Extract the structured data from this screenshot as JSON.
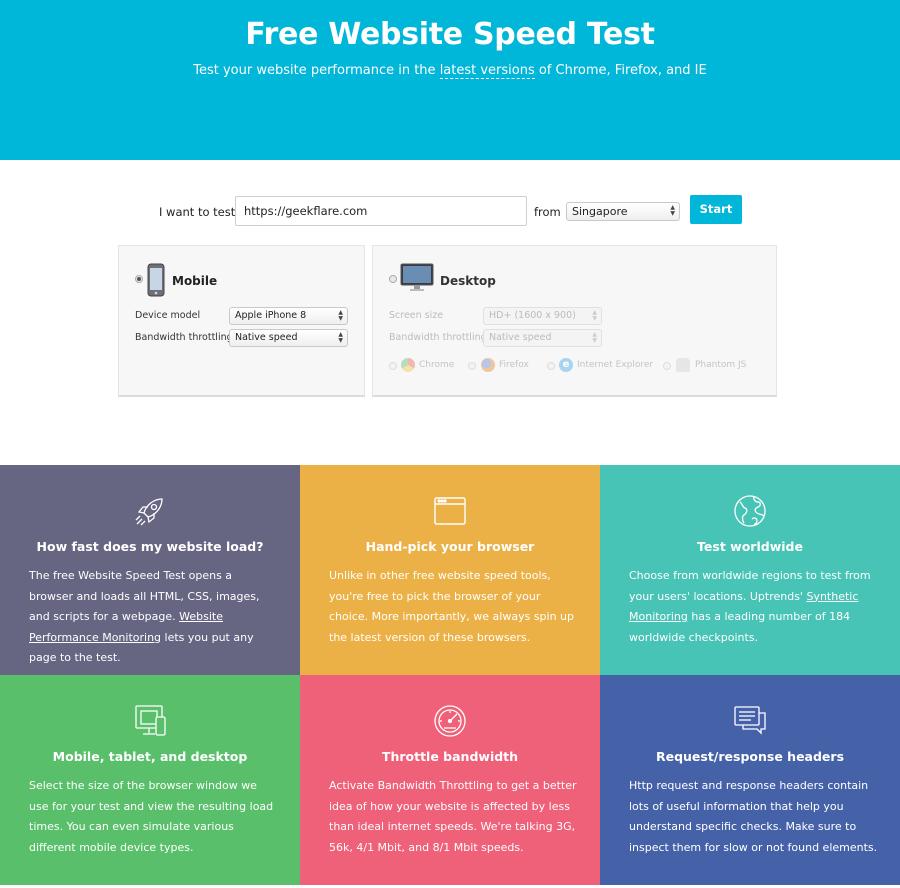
{
  "hero": {
    "title": "Free Website Speed Test",
    "subtitle_before": "Test your website performance in the ",
    "subtitle_link": "latest versions",
    "subtitle_after": " of Chrome, Firefox, and IE",
    "background": "#00b6d9"
  },
  "form": {
    "want_label": "I want to test",
    "url_value": "https://geekflare.com",
    "from_label": "from",
    "location": "Singapore",
    "start_label": "Start"
  },
  "mobile_panel": {
    "title": "Mobile",
    "selected": true,
    "device_label": "Device model",
    "device_value": "Apple iPhone 8",
    "bandwidth_label": "Bandwidth throttling",
    "bandwidth_value": "Native speed"
  },
  "desktop_panel": {
    "title": "Desktop",
    "selected": false,
    "screen_label": "Screen size",
    "screen_value": "HD+ (1600 x 900)",
    "bandwidth_label": "Bandwidth throttling",
    "bandwidth_value": "Native speed",
    "browsers": [
      "Chrome",
      "Firefox",
      "Internet Explorer",
      "Phantom JS"
    ]
  },
  "features": [
    {
      "icon": "rocket-icon",
      "color": "#666582",
      "title": "How fast does my website load?",
      "text1": "The free Website Speed Test opens a browser and loads all HTML, CSS, images, and scripts for a webpage. ",
      "link": "Website Performance Monitoring",
      "text2": " lets you put any page to the test."
    },
    {
      "icon": "browser-window-icon",
      "color": "#ebb146",
      "title": "Hand-pick your browser",
      "text1": "Unlike in other free website speed tools, you're free to pick the browser of your choice. More importantly, we always spin up the latest version of these browsers.",
      "link": "",
      "text2": ""
    },
    {
      "icon": "globe-icon",
      "color": "#48c4b6",
      "title": "Test worldwide",
      "text1": "Choose from worldwide regions to test from your users' locations. Uptrends' ",
      "link": "Synthetic Monitoring",
      "text2": " has a leading number of 184 worldwide checkpoints."
    },
    {
      "icon": "devices-icon",
      "color": "#5abf6b",
      "title": "Mobile, tablet, and desktop",
      "text1": "Select the size of the browser window we use for your test and view the resulting load times. You can even simulate various different mobile device types.",
      "link": "",
      "text2": ""
    },
    {
      "icon": "speedometer-icon",
      "color": "#ef6079",
      "title": "Throttle bandwidth",
      "text1": "Activate Bandwidth Throttling to get a better idea of how your website is affected by less than ideal internet speeds. We're talking 3G, 56k, 4/1 Mbit, and 8/1 Mbit speeds.",
      "link": "",
      "text2": ""
    },
    {
      "icon": "chat-headers-icon",
      "color": "#4562a9",
      "title": "Request/response headers",
      "text1": "Http request and response headers contain lots of useful information that help you understand specific checks. Make sure to inspect them for slow or not found elements.",
      "link": "",
      "text2": ""
    }
  ]
}
